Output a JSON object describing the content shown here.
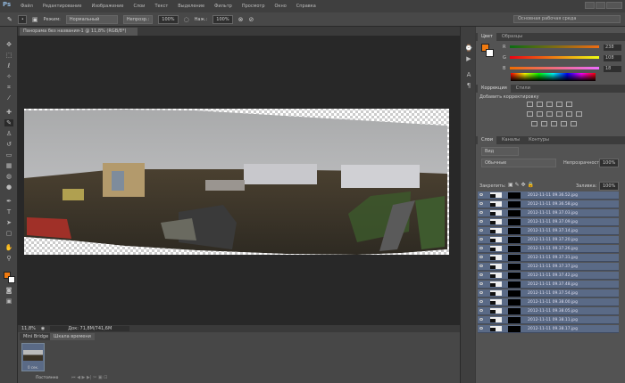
{
  "app": {
    "logo": "Ps"
  },
  "menu": [
    "Файл",
    "Редактирование",
    "Изображение",
    "Слои",
    "Текст",
    "Выделение",
    "Фильтр",
    "Просмотр",
    "Окно",
    "Справка"
  ],
  "options": {
    "mode_label": "Режим:",
    "mode_value": "Нормальный",
    "opacity_label": "Непрозр.:",
    "opacity_value": "100%",
    "flow_label": "Наж.:",
    "flow_value": "100%",
    "workspace": "Основная рабочая среда"
  },
  "document": {
    "tab_title": "Панорама без названия-1 @ 11,8% (RGB/8*)",
    "zoom": "11,8%",
    "doc_info": "Док: 71,8M/741,6M"
  },
  "bottom": {
    "tabs": [
      "Mini Bridge",
      "Шкала времени"
    ],
    "frame_time": "0 сек.",
    "loop": "Постоянно"
  },
  "color_panel": {
    "tabs": [
      "Цвет",
      "Образцы"
    ],
    "foreground": "#f07a10",
    "channels": [
      {
        "label": "R",
        "value": "238"
      },
      {
        "label": "G",
        "value": "108"
      },
      {
        "label": "B",
        "value": "18"
      }
    ]
  },
  "adjust_panel": {
    "tabs": [
      "Коррекция",
      "Стили"
    ],
    "title": "Добавить корректировку"
  },
  "layers_panel": {
    "tabs": [
      "Слои",
      "Каналы",
      "Контуры"
    ],
    "filter": "Вид",
    "blend": "Обычные",
    "opacity_label": "Непрозрачность:",
    "opacity": "100%",
    "lock_label": "Закрепить:",
    "fill_label": "Заливка:",
    "fill": "100%",
    "layers": [
      "2012-11-11 09.36.52.jpg",
      "2012-11-11 09.36.58.jpg",
      "2012-11-11 09.37.03.jpg",
      "2012-11-11 09.37.09.jpg",
      "2012-11-11 09.37.14.jpg",
      "2012-11-11 09.37.20.jpg",
      "2012-11-11 09.37.26.jpg",
      "2012-11-11 09.37.31.jpg",
      "2012-11-11 09.37.37.jpg",
      "2012-11-11 09.37.42.jpg",
      "2012-11-11 09.37.48.jpg",
      "2012-11-11 09.37.54.jpg",
      "2012-11-11 09.38.00.jpg",
      "2012-11-11 09.38.05.jpg",
      "2012-11-11 09.38.11.jpg",
      "2012-11-11 09.38.17.jpg"
    ]
  }
}
